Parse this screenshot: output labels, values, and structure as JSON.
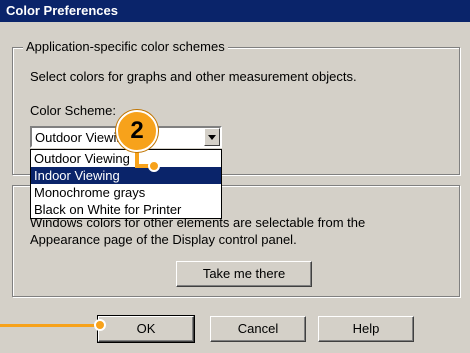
{
  "window": {
    "title": "Color Preferences"
  },
  "app_schemes": {
    "legend": "Application-specific color schemes",
    "description": "Select colors for graphs and other measurement objects.",
    "scheme_label": "Color Scheme:",
    "combo_value": "Outdoor Viewing",
    "options": [
      "Outdoor Viewing",
      "Indoor Viewing",
      "Monochrome grays",
      "Black on White for Printer"
    ],
    "selected_option": "Indoor Viewing"
  },
  "windows_colors": {
    "line1": "Windows colors for other elements are selectable from the",
    "line2": "Appearance page of the Display control panel.",
    "button_label": "Take me there"
  },
  "footer": {
    "ok_label": "OK",
    "cancel_label": "Cancel",
    "help_label": "Help"
  },
  "callout": {
    "number": "2",
    "color": "#f7a21b"
  }
}
